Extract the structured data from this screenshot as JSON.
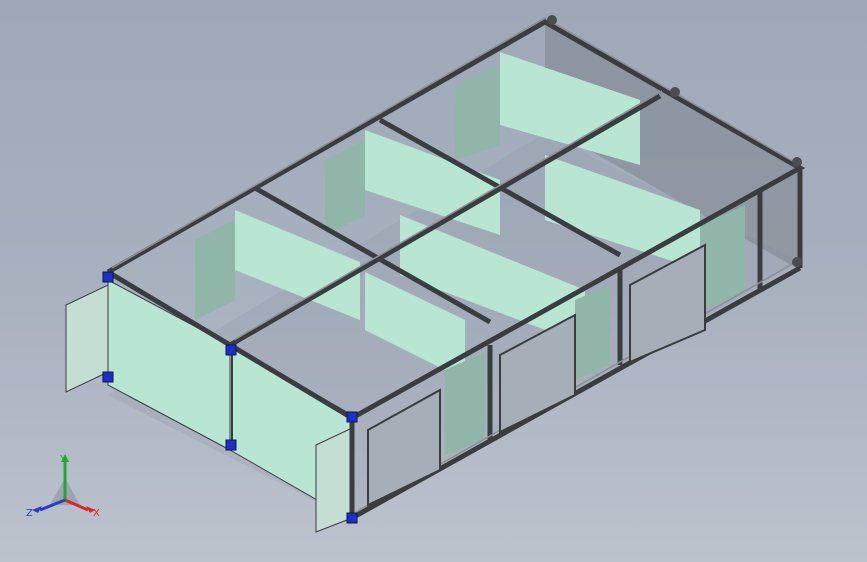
{
  "scene": {
    "background_top": "#9ea8b7",
    "background_bottom": "#bcc3cd",
    "frame_color": "#3a3d40",
    "frame_highlight": "#7f858a",
    "panel_color": "#b8e6d3",
    "panel_shade": "#9fc7b8",
    "door_color": "#c4ded3",
    "connector_color": "#1c2fc8"
  },
  "triad": {
    "y_label": "Y",
    "x_label": "X",
    "z_label": "Z",
    "y_color": "#1fa833",
    "x_color": "#d8262e",
    "z_color": "#2a3cc7"
  }
}
